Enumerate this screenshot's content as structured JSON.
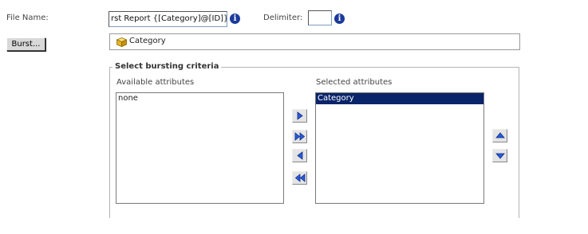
{
  "file_name": {
    "label": "File Name:",
    "value": "rst Report {[Category]@[ID]}"
  },
  "delimiter": {
    "label": "Delimiter:",
    "value": ""
  },
  "burst_button": {
    "label": "Burst..."
  },
  "burst_group": {
    "icon": "cube-icon",
    "label": "Category"
  },
  "bursting_criteria": {
    "legend": "Select bursting criteria",
    "available": {
      "label": "Available attributes",
      "items": [
        "none"
      ]
    },
    "selected": {
      "label": "Selected attributes",
      "items": [
        "Category"
      ]
    }
  },
  "icons": {
    "info": "info-icon",
    "add": "arrow-right-icon",
    "add_all": "double-arrow-right-icon",
    "remove": "arrow-left-icon",
    "remove_all": "double-arrow-left-icon",
    "move_up": "arrow-up-icon",
    "move_down": "arrow-down-icon"
  },
  "colors": {
    "selection": "#0a246a",
    "arrow_blue": "#2a5bd7"
  }
}
